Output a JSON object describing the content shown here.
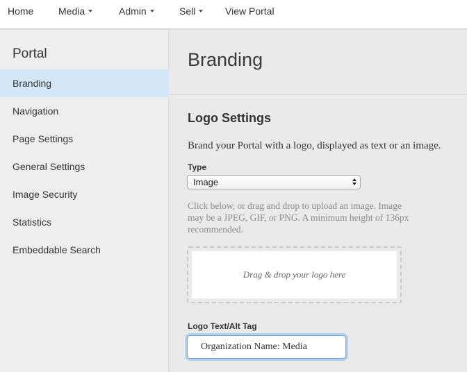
{
  "topnav": {
    "items": [
      {
        "label": "Home",
        "has_caret": false
      },
      {
        "label": "Media",
        "has_caret": true
      },
      {
        "label": "Admin",
        "has_caret": true
      },
      {
        "label": "Sell",
        "has_caret": true
      },
      {
        "label": "View Portal",
        "has_caret": false
      }
    ]
  },
  "sidebar": {
    "title": "Portal",
    "items": [
      {
        "label": "Branding",
        "active": true
      },
      {
        "label": "Navigation",
        "active": false
      },
      {
        "label": "Page Settings",
        "active": false
      },
      {
        "label": "General Settings",
        "active": false
      },
      {
        "label": "Image Security",
        "active": false
      },
      {
        "label": "Statistics",
        "active": false
      },
      {
        "label": "Embeddable Search",
        "active": false
      }
    ]
  },
  "main": {
    "page_title": "Branding",
    "section_title": "Logo Settings",
    "section_desc": "Brand your Portal with a logo, displayed as text or an image.",
    "type_label": "Type",
    "type_value": "Image",
    "help_text": "Click below, or drag and drop to upload an image. Image may be a JPEG, GIF, or PNG. A minimum height of 136px recommended.",
    "dropzone_text": "Drag & drop your logo here",
    "alt_label": "Logo Text/Alt Tag",
    "alt_value": "Organization Name: Media"
  },
  "colors": {
    "active_sidebar_bg": "#d4e7f6",
    "focus_ring": "#6aa9e6"
  }
}
